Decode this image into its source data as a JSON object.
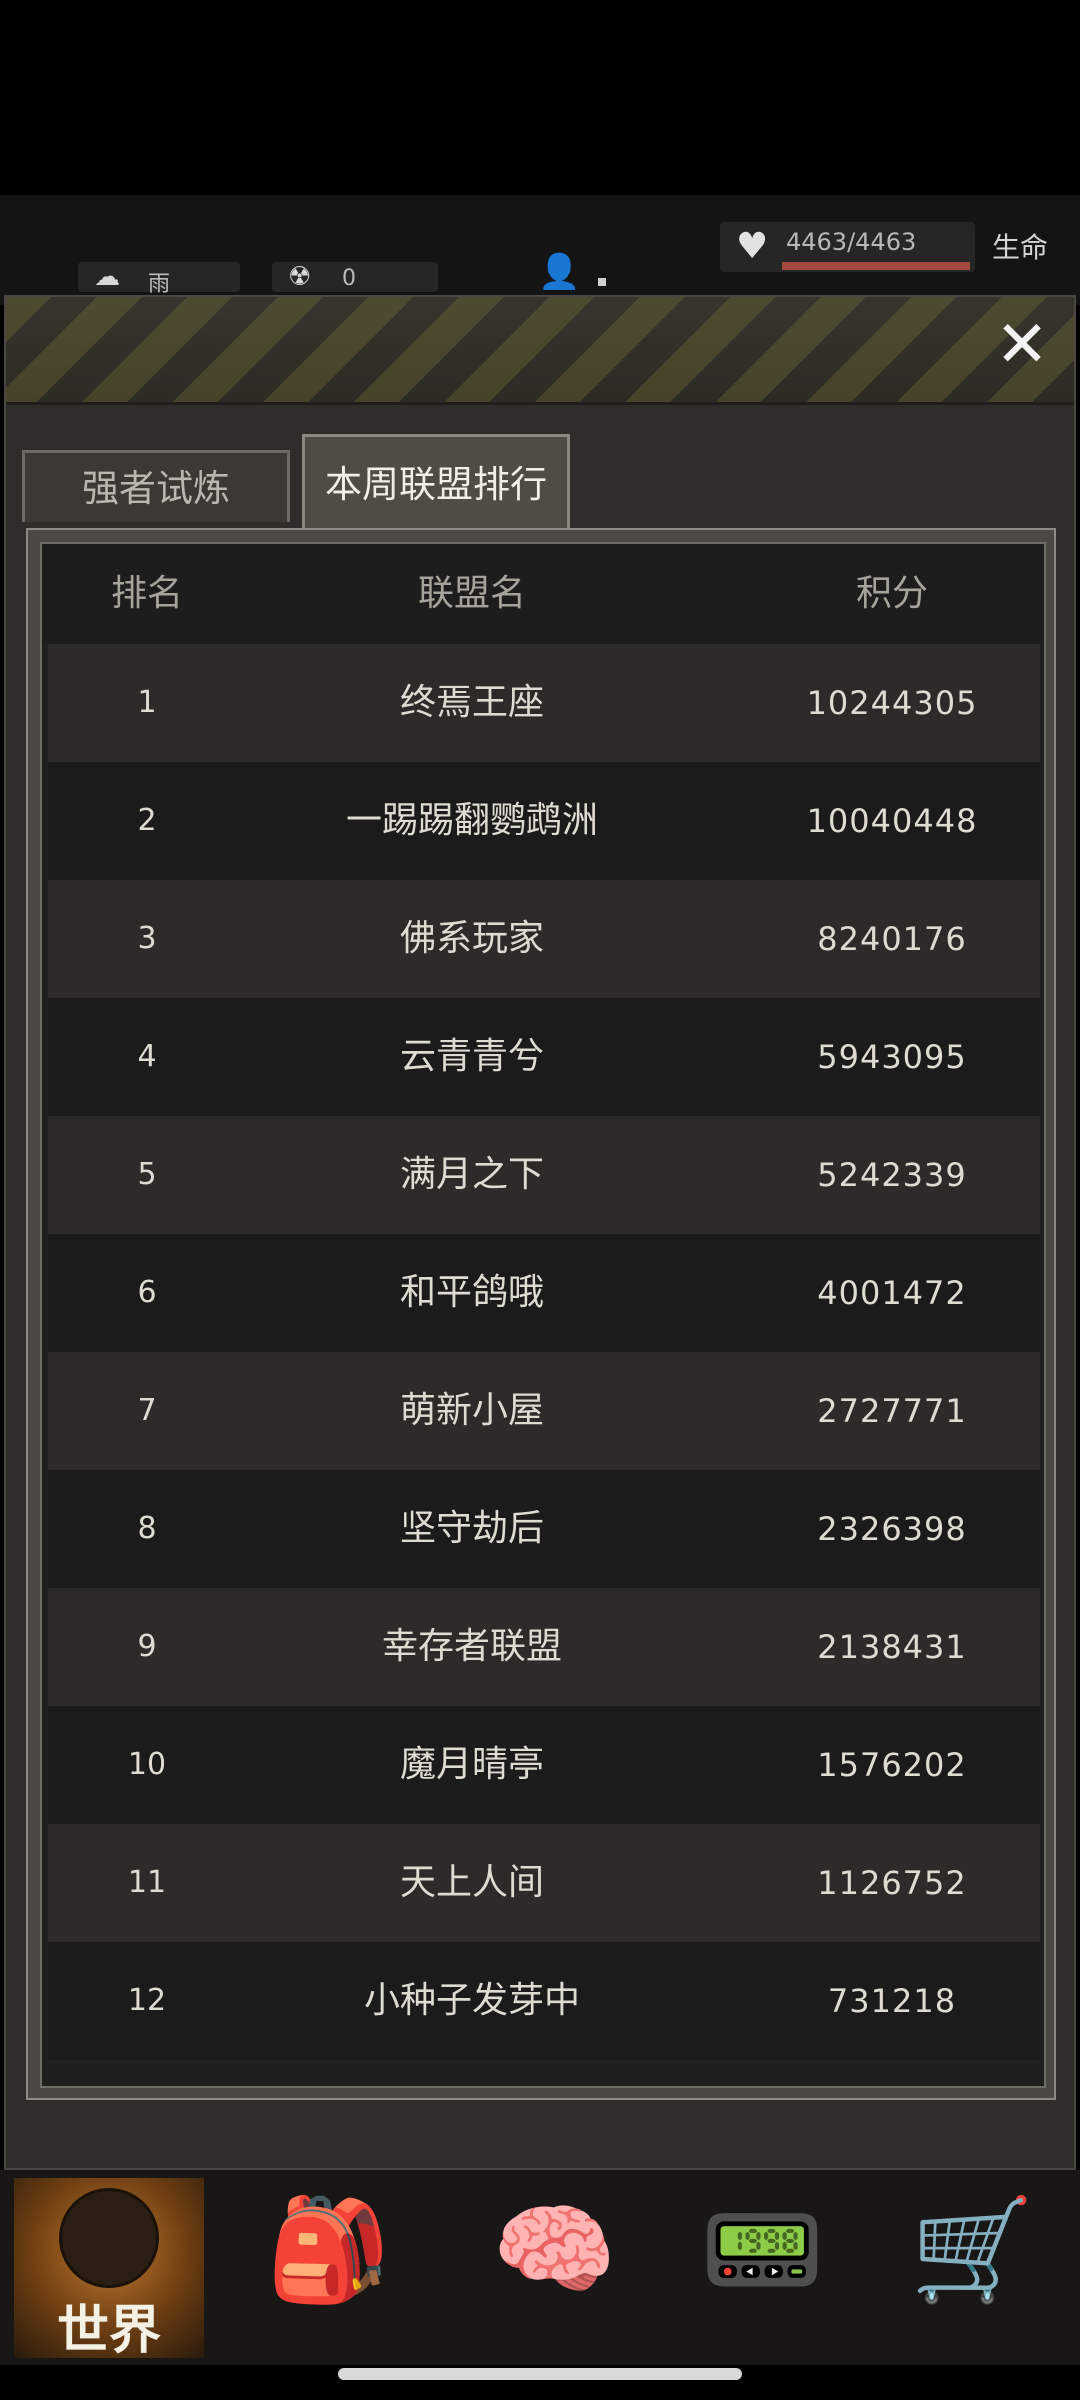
{
  "status": {
    "weather_icon": "cloud-rain-icon",
    "weather_label": "雨",
    "radiation_icon": "radiation-icon",
    "radiation_value": "0",
    "life_value": "4463/4463",
    "life_ratio": 1.0,
    "life_label": "生命",
    "life_color": "#a4483f"
  },
  "modal": {
    "close_icon": "close-icon",
    "tabs": [
      {
        "label": "强者试炼",
        "active": false
      },
      {
        "label": "本周联盟排行",
        "active": true
      }
    ]
  },
  "table": {
    "headers": {
      "rank": "排名",
      "name": "联盟名",
      "score": "积分"
    },
    "rows": [
      {
        "rank": "1",
        "name": "终焉王座",
        "score": "10244305"
      },
      {
        "rank": "2",
        "name": "一踢踢翻鹦鹉洲",
        "score": "10040448"
      },
      {
        "rank": "3",
        "name": "佛系玩家",
        "score": "8240176"
      },
      {
        "rank": "4",
        "name": "云青青兮",
        "score": "5943095"
      },
      {
        "rank": "5",
        "name": "满月之下",
        "score": "5242339"
      },
      {
        "rank": "6",
        "name": "和平鸽哦",
        "score": "4001472"
      },
      {
        "rank": "7",
        "name": "萌新小屋",
        "score": "2727771"
      },
      {
        "rank": "8",
        "name": "坚守劫后",
        "score": "2326398"
      },
      {
        "rank": "9",
        "name": "幸存者联盟",
        "score": "2138431"
      },
      {
        "rank": "10",
        "name": "魔月晴亭",
        "score": "1576202"
      },
      {
        "rank": "11",
        "name": "天上人间",
        "score": "1126752"
      },
      {
        "rank": "12",
        "name": "小种子发芽中",
        "score": "731218"
      }
    ]
  },
  "nav": {
    "world_label": "世界",
    "items": [
      "globe-icon",
      "backpack-icon",
      "head-gears-icon",
      "radio-icon",
      "cart-icon"
    ]
  }
}
